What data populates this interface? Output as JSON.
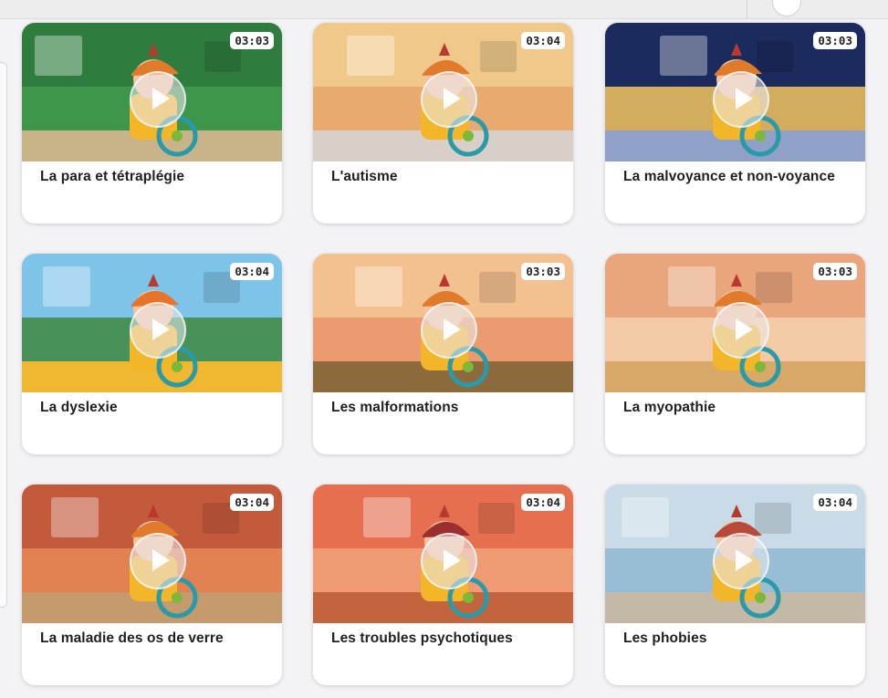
{
  "videos": [
    {
      "title": "La para et tétraplégie",
      "duration": "03:03",
      "colors": {
        "sky": "#2f7d3e",
        "mid": "#3f9a4b",
        "floor": "#c9b48a",
        "accent": "#e07b2c"
      }
    },
    {
      "title": "L'autisme",
      "duration": "03:04",
      "colors": {
        "sky": "#f0c98a",
        "mid": "#e8a46a",
        "floor": "#d8d0c8",
        "accent": "#e07b2c"
      }
    },
    {
      "title": "La malvoyance et non-voyance",
      "duration": "03:03",
      "colors": {
        "sky": "#1c2b5e",
        "mid": "#f2c45e",
        "floor": "#8fa1c8",
        "accent": "#e07b2c"
      }
    },
    {
      "title": "La dyslexie",
      "duration": "03:04",
      "colors": {
        "sky": "#7ec3e8",
        "mid": "#3e8a3f",
        "floor": "#f0b830",
        "accent": "#e8732a"
      }
    },
    {
      "title": "Les malformations",
      "duration": "03:03",
      "colors": {
        "sky": "#f3c08f",
        "mid": "#e9946a",
        "floor": "#8c6a3b",
        "accent": "#e07b2c"
      }
    },
    {
      "title": "La myopathie",
      "duration": "03:03",
      "colors": {
        "sky": "#e9a57c",
        "mid": "#f4cfae",
        "floor": "#d7a868",
        "accent": "#e07b2c"
      }
    },
    {
      "title": "La maladie des os de verre",
      "duration": "03:04",
      "colors": {
        "sky": "#c45a3c",
        "mid": "#e88a56",
        "floor": "#c59a6c",
        "accent": "#e07b2c"
      }
    },
    {
      "title": "Les troubles psychotiques",
      "duration": "03:04",
      "colors": {
        "sky": "#e56f4f",
        "mid": "#f2a27a",
        "floor": "#c4643f",
        "accent": "#9b2f2f"
      }
    },
    {
      "title": "Les phobies",
      "duration": "03:04",
      "colors": {
        "sky": "#c8dbe6",
        "mid": "#8eb8d0",
        "floor": "#c4b9a7",
        "accent": "#b84a3a"
      }
    }
  ]
}
